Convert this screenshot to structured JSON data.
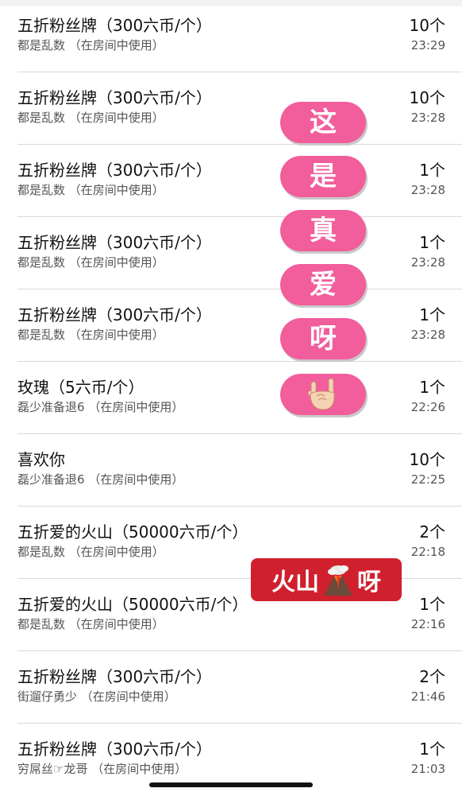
{
  "records": [
    {
      "title": "五折粉丝牌（300六币/个）",
      "sender": "都是乱数",
      "note": "（在房间中使用）",
      "count": "10个",
      "time": "23:29"
    },
    {
      "title": "五折粉丝牌（300六币/个）",
      "sender": "都是乱数",
      "note": "（在房间中使用）",
      "count": "10个",
      "time": "23:28"
    },
    {
      "title": "五折粉丝牌（300六币/个）",
      "sender": "都是乱数",
      "note": "（在房间中使用）",
      "count": "1个",
      "time": "23:28"
    },
    {
      "title": "五折粉丝牌（300六币/个）",
      "sender": "都是乱数",
      "note": "（在房间中使用）",
      "count": "1个",
      "time": "23:28"
    },
    {
      "title": "五折粉丝牌（300六币/个）",
      "sender": "都是乱数",
      "note": "（在房间中使用）",
      "count": "1个",
      "time": "23:28"
    },
    {
      "title": "玫瑰（5六币/个）",
      "sender": "磊少准备退6",
      "note": "（在房间中使用）",
      "count": "1个",
      "time": "22:26"
    },
    {
      "title": "喜欢你",
      "sender": "磊少准备退6",
      "note": "（在房间中使用）",
      "count": "10个",
      "time": "22:25"
    },
    {
      "title": "五折爱的火山（50000六币/个）",
      "sender": "都是乱数",
      "note": "（在房间中使用）",
      "count": "2个",
      "time": "22:18"
    },
    {
      "title": "五折爱的火山（50000六币/个）",
      "sender": "都是乱数",
      "note": "（在房间中使用）",
      "count": "1个",
      "time": "22:16"
    },
    {
      "title": "五折粉丝牌（300六币/个）",
      "sender": "街遛仔勇少",
      "note": "（在房间中使用）",
      "count": "2个",
      "time": "21:46"
    },
    {
      "title": "五折粉丝牌（300六币/个）",
      "sender": "穷屌丝☞龙哥",
      "note": "（在房间中使用）",
      "count": "1个",
      "time": "21:03"
    }
  ],
  "stickers": {
    "pills": [
      "这",
      "是",
      "真",
      "爱",
      "呀"
    ],
    "hand_icon": "rock-on-hand-icon",
    "volcano_left": "火山",
    "volcano_icon": "volcano-icon",
    "volcano_right": "呀"
  },
  "colors": {
    "pill": "#f25d9c",
    "volcano_sticker": "#d0202e"
  }
}
